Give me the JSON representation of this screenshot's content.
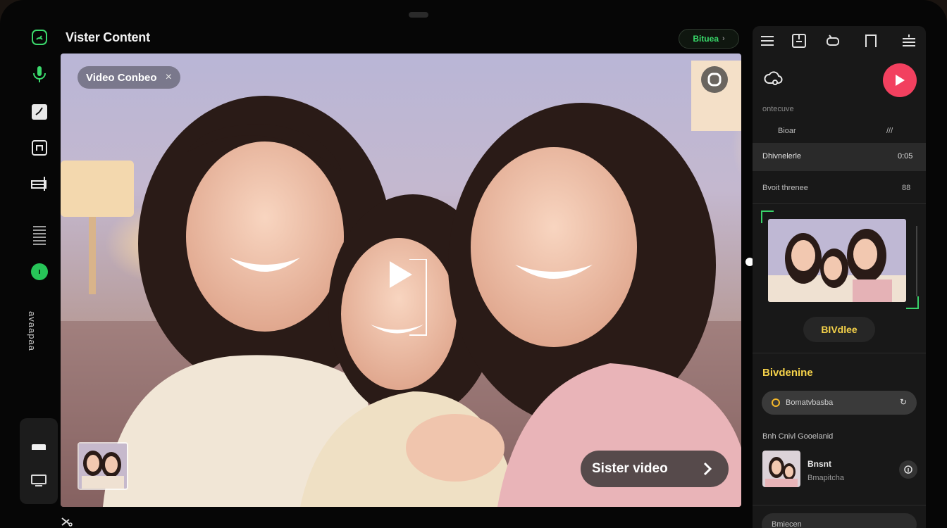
{
  "app": {
    "title": "Vister Content",
    "badge": "Bituea"
  },
  "rail": {
    "icons": [
      "speedometer-icon",
      "microphone-icon",
      "clock-icon",
      "frame-icon",
      "grid-icon",
      "lines-icon",
      "green-dot-icon"
    ],
    "vertical_label": "avaapaa",
    "bottom_icons": [
      "card-icon",
      "monitor-icon"
    ]
  },
  "video": {
    "chip_label": "Video Conbeo",
    "chip_close": "×",
    "pill_label": "Sister video"
  },
  "panel": {
    "toolbar_icons": [
      "menu-icon",
      "save-icon",
      "loop-icon",
      "bookmark-icon",
      "sort-icon"
    ],
    "rows": [
      {
        "label": "ontecuve",
        "value": ""
      },
      {
        "label": "Bioar",
        "value": "///"
      },
      {
        "label": "Dhivnelerle",
        "value": "0:05"
      },
      {
        "label": "Bvoit threnee",
        "value": "88"
      }
    ],
    "preview_button": "BIVdlee",
    "section_title": "Bivdenine",
    "search_text": "Bomatvbasba",
    "list_header": "Bnh Cnivl Gooelanid",
    "item": {
      "title": "Bnsnt",
      "subtitle": "Bmapitcha"
    },
    "bottom_label": "Bmiecen"
  },
  "colors": {
    "accent_green": "#38d96a",
    "accent_yellow": "#f5d24a",
    "record_red": "#f2405f"
  }
}
